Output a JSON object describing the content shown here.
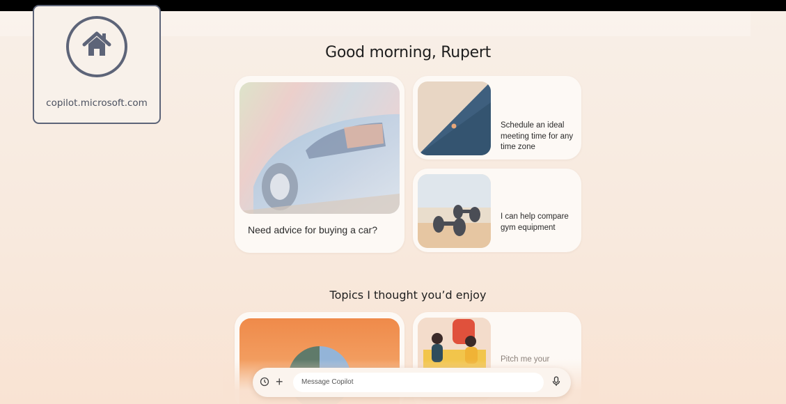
{
  "bookmark": {
    "url": "copilot.microsoft.com",
    "icon": "home-icon"
  },
  "greeting": "Good morning, Rupert",
  "cards": [
    {
      "label": "Need advice for buying a car?",
      "image": "car-illustration"
    },
    {
      "label": "Schedule an ideal meeting time for any time zone",
      "image": "horizon-illustration"
    },
    {
      "label": "I can help compare gym equipment",
      "image": "dumbbells-illustration"
    }
  ],
  "topics": {
    "title": "Topics I thought you’d enjoy",
    "cards": [
      {
        "label": "",
        "image": "pie-chart-illustration"
      },
      {
        "label": "Pitch me your",
        "image": "people-conversation-illustration"
      }
    ]
  },
  "composer": {
    "placeholder": "Message Copilot",
    "history_icon": "history-icon",
    "add_icon": "plus-icon",
    "mic_icon": "microphone-icon"
  }
}
